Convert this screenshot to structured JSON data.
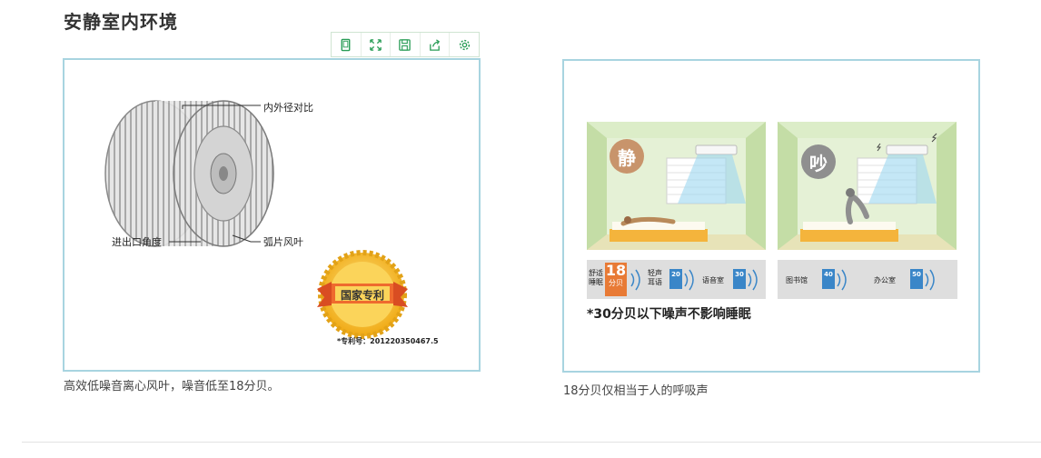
{
  "page_title": "安静室内环境",
  "toolbar": {
    "tools": [
      {
        "name": "page",
        "icon": "page-icon"
      },
      {
        "name": "fullscreen",
        "icon": "expand-icon"
      },
      {
        "name": "save",
        "icon": "save-icon"
      },
      {
        "name": "share",
        "icon": "share-icon"
      },
      {
        "name": "settings",
        "icon": "gear-icon"
      }
    ]
  },
  "left_panel": {
    "labels": {
      "diameter_ratio": "内外径对比",
      "inlet_angle": "进出口角度",
      "arc_blade": "弧片风叶"
    },
    "seal_text": "国家专利",
    "patent_no": "*专利号：201220350467.5",
    "caption": "高效低噪音离心风叶，噪音低至18分贝。"
  },
  "right_panel": {
    "badge_quiet": "静",
    "badge_noisy": "吵",
    "scale": {
      "comfortable_sleep": "舒适\n睡眠",
      "big_value": "18",
      "big_unit": "分贝",
      "whisper": "轻声\n耳语",
      "whisper_db": "20",
      "language_room": "语音室",
      "language_db": "30",
      "library": "图书馆",
      "library_db": "40",
      "office": "办公室",
      "office_db": "50",
      "db_unit": "分贝"
    },
    "note": "*30分贝以下噪声不影响睡眠",
    "caption": "18分贝仅相当于人的呼吸声"
  },
  "colors": {
    "toolbar_icon": "#2a9d57",
    "panel_border": "#a8d4e0",
    "scale_blue": "#3a86c8",
    "scale_orange": "#e87a35",
    "seal_gold": "#f2b320",
    "ribbon_red": "#e55b2d"
  }
}
